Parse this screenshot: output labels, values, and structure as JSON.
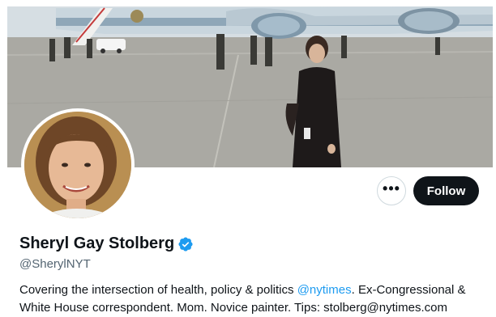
{
  "profile": {
    "display_name": "Sheryl Gay Stolberg",
    "handle": "@SherylNYT",
    "verified": true,
    "bio": {
      "before_mention": "Covering the intersection of health, policy & politics ",
      "mention": "@nytimes",
      "after_mention": ". Ex-Congressional & White House correspondent. Mom. Novice painter. Tips: stolberg@nytimes.com"
    }
  },
  "actions": {
    "more_label": "•••",
    "follow_label": "Follow"
  },
  "icons": {
    "verified": "verified-badge-icon",
    "more": "more-options-icon"
  },
  "colors": {
    "follow_bg": "#0f1419",
    "mention": "#1d9bf0",
    "verified": "#1d9bf0",
    "handle": "#536471"
  }
}
